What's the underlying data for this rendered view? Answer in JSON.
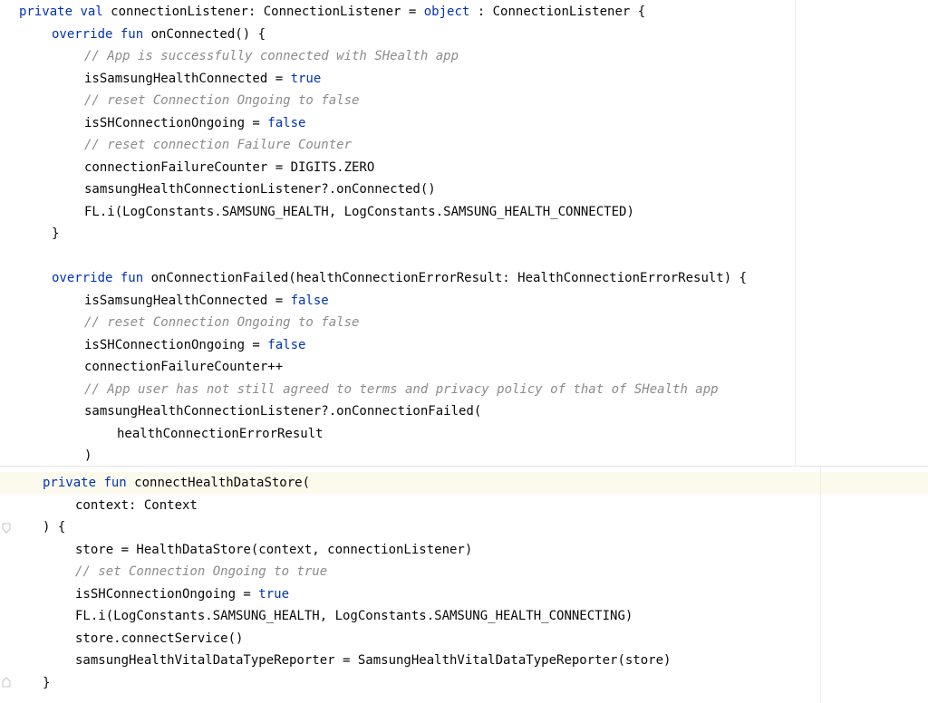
{
  "editor": {
    "language": "Kotlin",
    "colors": {
      "background": "#ffffff",
      "keyword": "#0033b3",
      "comment": "#8c8c8c",
      "text": "#080808",
      "current_line": "#fcfaed"
    },
    "top_pane": {
      "lines": [
        {
          "indent": 0,
          "tokens": [
            {
              "t": "kw",
              "s": "private "
            },
            {
              "t": "kw",
              "s": "val "
            },
            {
              "t": "tx",
              "s": "connectionListener: ConnectionListener = "
            },
            {
              "t": "kwb",
              "s": "object"
            },
            {
              "t": "tx",
              "s": " : ConnectionListener {"
            }
          ]
        },
        {
          "indent": 1,
          "tokens": [
            {
              "t": "kw",
              "s": "override "
            },
            {
              "t": "kw",
              "s": "fun "
            },
            {
              "t": "tx",
              "s": "onConnected() {"
            }
          ]
        },
        {
          "indent": 2,
          "tokens": [
            {
              "t": "cm",
              "s": "// App is successfully connected with SHealth app"
            }
          ]
        },
        {
          "indent": 2,
          "tokens": [
            {
              "t": "tx",
              "s": "isSamsungHealthConnected = "
            },
            {
              "t": "kwb",
              "s": "true"
            }
          ]
        },
        {
          "indent": 2,
          "tokens": [
            {
              "t": "cm",
              "s": "// reset Connection Ongoing to false"
            }
          ]
        },
        {
          "indent": 2,
          "tokens": [
            {
              "t": "tx",
              "s": "isSHConnectionOngoing = "
            },
            {
              "t": "kwb",
              "s": "false"
            }
          ]
        },
        {
          "indent": 2,
          "tokens": [
            {
              "t": "cm",
              "s": "// reset connection Failure Counter"
            }
          ]
        },
        {
          "indent": 2,
          "tokens": [
            {
              "t": "tx",
              "s": "connectionFailureCounter = DIGITS.ZERO"
            }
          ]
        },
        {
          "indent": 2,
          "tokens": [
            {
              "t": "tx",
              "s": "samsungHealthConnectionListener?.onConnected()"
            }
          ]
        },
        {
          "indent": 2,
          "tokens": [
            {
              "t": "tx",
              "s": "FL.i(LogConstants.SAMSUNG_HEALTH, LogConstants.SAMSUNG_HEALTH_CONNECTED)"
            }
          ]
        },
        {
          "indent": 1,
          "tokens": [
            {
              "t": "tx",
              "s": "}"
            }
          ]
        },
        {
          "indent": 0,
          "tokens": []
        },
        {
          "indent": 1,
          "tokens": [
            {
              "t": "kw",
              "s": "override "
            },
            {
              "t": "kw",
              "s": "fun "
            },
            {
              "t": "tx",
              "s": "onConnectionFailed(healthConnectionErrorResult: HealthConnectionErrorResult) {"
            }
          ]
        },
        {
          "indent": 2,
          "tokens": [
            {
              "t": "tx",
              "s": "isSamsungHealthConnected = "
            },
            {
              "t": "kwb",
              "s": "false"
            }
          ]
        },
        {
          "indent": 2,
          "tokens": [
            {
              "t": "cm",
              "s": "// reset Connection Ongoing to false"
            }
          ]
        },
        {
          "indent": 2,
          "tokens": [
            {
              "t": "tx",
              "s": "isSHConnectionOngoing = "
            },
            {
              "t": "kwb",
              "s": "false"
            }
          ]
        },
        {
          "indent": 2,
          "tokens": [
            {
              "t": "tx",
              "s": "connectionFailureCounter++"
            }
          ]
        },
        {
          "indent": 2,
          "tokens": [
            {
              "t": "cm",
              "s": "// App user has not still agreed to terms and privacy policy of that of SHealth app"
            }
          ]
        },
        {
          "indent": 2,
          "tokens": [
            {
              "t": "tx",
              "s": "samsungHealthConnectionListener?.onConnectionFailed("
            }
          ]
        },
        {
          "indent": 3,
          "tokens": [
            {
              "t": "tx",
              "s": "healthConnectionErrorResult"
            }
          ]
        },
        {
          "indent": 2,
          "tokens": [
            {
              "t": "tx",
              "s": ")"
            }
          ]
        }
      ]
    },
    "bottom_pane": {
      "lines": [
        {
          "indent": 0,
          "tokens": [
            {
              "t": "kw",
              "s": "private "
            },
            {
              "t": "kw",
              "s": "fun "
            },
            {
              "t": "tx",
              "s": "connectHealthDataStore("
            }
          ]
        },
        {
          "indent": 1,
          "tokens": [
            {
              "t": "tx",
              "s": "context: Context"
            }
          ]
        },
        {
          "indent": 0,
          "tokens": [
            {
              "t": "tx",
              "s": ") {"
            }
          ]
        },
        {
          "indent": 1,
          "tokens": [
            {
              "t": "tx",
              "s": "store = HealthDataStore(context, connectionListener)"
            }
          ]
        },
        {
          "indent": 1,
          "tokens": [
            {
              "t": "cm",
              "s": "// set Connection Ongoing to true"
            }
          ]
        },
        {
          "indent": 1,
          "tokens": [
            {
              "t": "tx",
              "s": "isSHConnectionOngoing = "
            },
            {
              "t": "kwb",
              "s": "true"
            }
          ]
        },
        {
          "indent": 1,
          "tokens": [
            {
              "t": "tx",
              "s": "FL.i(LogConstants.SAMSUNG_HEALTH, LogConstants.SAMSUNG_HEALTH_CONNECTING)"
            }
          ]
        },
        {
          "indent": 1,
          "tokens": [
            {
              "t": "tx",
              "s": "store.connectService()"
            }
          ]
        },
        {
          "indent": 1,
          "tokens": [
            {
              "t": "tx",
              "s": "samsungHealthVitalDataTypeReporter = SamsungHealthVitalDataTypeReporter(store)"
            }
          ]
        },
        {
          "indent": 0,
          "tokens": [
            {
              "t": "tx",
              "s": "}"
            }
          ]
        }
      ],
      "gutter_icons": [
        "fold-marker-icon",
        "fold-marker-icon"
      ]
    }
  }
}
